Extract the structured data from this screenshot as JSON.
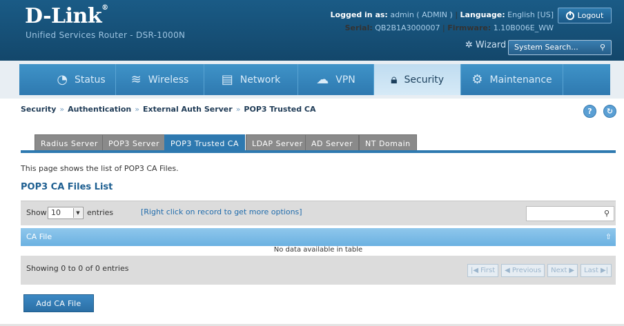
{
  "header": {
    "logo_text": "D-Link",
    "logo_mark": "®",
    "subtitle": "Unified Services Router - DSR-1000N",
    "logged_in_label": "Logged in as:",
    "logged_in_user": "admin ( ADMIN )",
    "language_label": "Language:",
    "language_value": "English [US]",
    "serial_label": "Serial:",
    "serial_value": "QB2B1A3000007",
    "firmware_label": "Firmware:",
    "firmware_value": "1.10B006E_WW",
    "logout_label": "Logout",
    "wizard_label": "Wizard",
    "search_placeholder": "System Search..."
  },
  "nav": {
    "items": [
      {
        "label": "Status",
        "icon": "gauge-icon"
      },
      {
        "label": "Wireless",
        "icon": "wifi-icon"
      },
      {
        "label": "Network",
        "icon": "monitor-icon"
      },
      {
        "label": "VPN",
        "icon": "vpn-icon"
      },
      {
        "label": "Security",
        "icon": "lock-icon",
        "active": true
      },
      {
        "label": "Maintenance",
        "icon": "gears-icon"
      }
    ]
  },
  "breadcrumb": {
    "items": [
      "Security",
      "Authentication",
      "External Auth Server",
      "POP3 Trusted CA"
    ],
    "separator": "»"
  },
  "tabs": {
    "items": [
      "Radius Server",
      "POP3 Server",
      "POP3 Trusted CA",
      "LDAP Server",
      "AD Server",
      "NT Domain"
    ],
    "active": "POP3 Trusted CA"
  },
  "main": {
    "description": "This page shows the list of POP3 CA Files.",
    "list_title": "POP3 CA Files List",
    "show_label": "Show",
    "entries_value": "10",
    "entries_label": "entries",
    "right_click_hint": "[Right click on record to get more options]",
    "column_header": "CA File",
    "no_data": "No data available in table",
    "showing": "Showing 0 to 0 of 0 entries",
    "pager": {
      "first": "First",
      "previous": "Previous",
      "next": "Next",
      "last": "Last"
    },
    "add_button": "Add CA File"
  }
}
